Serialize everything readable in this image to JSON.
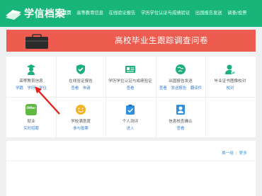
{
  "header": {
    "logo_text": "学信档案",
    "nav": [
      {
        "label": "首页"
      },
      {
        "label": "高等教育信息"
      },
      {
        "label": "在线验证报告"
      },
      {
        "label": "学历学位认证与成绩验证"
      },
      {
        "label": "出国报告发送"
      },
      {
        "label": "调查/投票"
      }
    ]
  },
  "banner": {
    "title": "高校毕业生跟踪调查问卷"
  },
  "tiles": [
    {
      "title": "高等教育信息",
      "links": [
        "学籍",
        "学历",
        "学位"
      ],
      "icon": "graduate-icon",
      "color": "#1db07a"
    },
    {
      "title": "在线验证报告",
      "links": [
        "查看",
        "申请"
      ],
      "icon": "shield-check-icon",
      "color": "#1db07a"
    },
    {
      "title": "学历学位认证与成绩验证",
      "links": [
        "查看"
      ],
      "icon": "id-card-icon",
      "color": "#1db07a"
    },
    {
      "title": "出国报告发送",
      "links": [
        "查看",
        "发送报告",
        "翻译件"
      ],
      "icon": "globe-icon",
      "color": "#1db07a"
    },
    {
      "title": "毕业证书图像校对",
      "links": [
        "校对"
      ],
      "icon": "user-check-icon",
      "color": "#1db07a"
    },
    {
      "title": "就业",
      "links": [
        "实时招聘"
      ],
      "icon": "offer-icon",
      "color": "#5fb840",
      "badge": "Offer"
    },
    {
      "title": "学校满意度",
      "links": [
        "参与投票"
      ],
      "icon": "smiley-icon",
      "color": "#f5b324"
    },
    {
      "title": "个人测评",
      "links": [
        "进入"
      ],
      "icon": "clipboard-check-icon",
      "color": "#2d8fe0"
    },
    {
      "title": "信息核查确认",
      "links": [
        "查看"
      ],
      "icon": "person-badge-icon",
      "color": "#2d8fe0"
    }
  ],
  "pager": {
    "prev": "换一组",
    "more": "更多"
  }
}
